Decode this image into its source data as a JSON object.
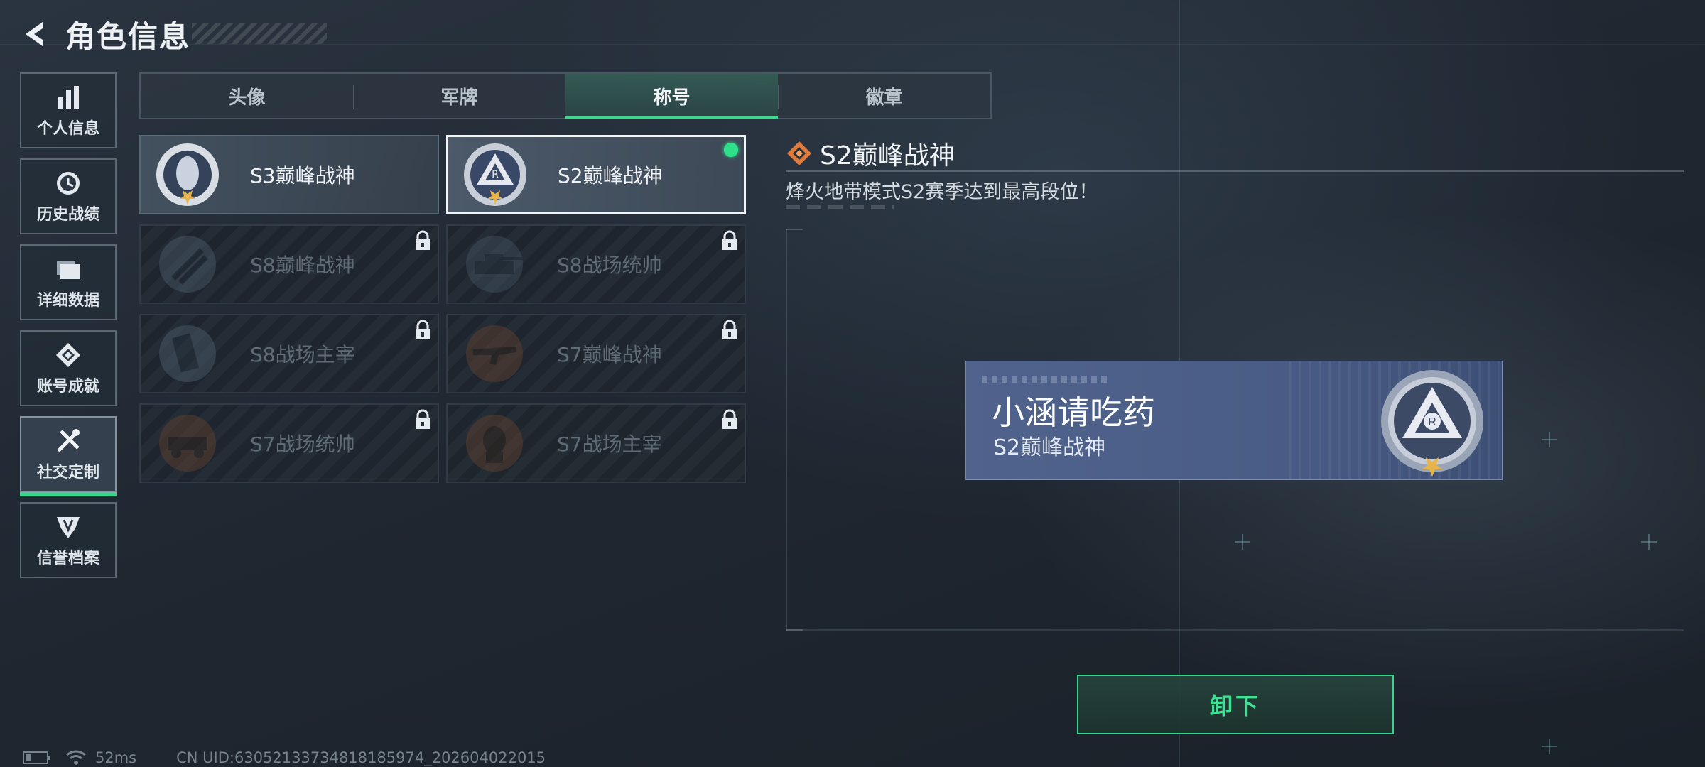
{
  "header": {
    "title": "角色信息"
  },
  "sidebar": {
    "items": [
      {
        "label": "个人信息",
        "icon": "bar-chart-icon"
      },
      {
        "label": "历史战绩",
        "icon": "clock-icon"
      },
      {
        "label": "详细数据",
        "icon": "folder-icon"
      },
      {
        "label": "账号成就",
        "icon": "achievement-icon"
      },
      {
        "label": "社交定制",
        "icon": "tools-icon",
        "active": true
      },
      {
        "label": "信誉档案",
        "icon": "credit-shield-icon"
      }
    ]
  },
  "tabs": [
    {
      "label": "头像"
    },
    {
      "label": "军牌"
    },
    {
      "label": "称号",
      "active": true
    },
    {
      "label": "徽章"
    }
  ],
  "titles": [
    {
      "name": "S3巅峰战神",
      "locked": false,
      "selected": false
    },
    {
      "name": "S2巅峰战神",
      "locked": false,
      "selected": true,
      "equipped": true
    },
    {
      "name": "S8巅峰战神",
      "locked": true
    },
    {
      "name": "S8战场统帅",
      "locked": true
    },
    {
      "name": "S8战场主宰",
      "locked": true
    },
    {
      "name": "S7巅峰战神",
      "locked": true
    },
    {
      "name": "S7战场统帅",
      "locked": true
    },
    {
      "name": "S7战场主宰",
      "locked": true
    }
  ],
  "detail": {
    "title": "S2巅峰战神",
    "description": "烽火地带模式S2赛季达到最高段位！"
  },
  "preview": {
    "player_name": "小涵请吃药",
    "title": "S2巅峰战神"
  },
  "actions": {
    "unequip_label": "卸下"
  },
  "footer": {
    "ping": "52ms",
    "uid": "CN UID:63052133734818185974_202604022015"
  },
  "colors": {
    "accent_green": "#3fd690",
    "equipped_dot": "#2fe08a",
    "plate_blue": "#4a5d86",
    "diamond_orange": "#e07a3a"
  }
}
